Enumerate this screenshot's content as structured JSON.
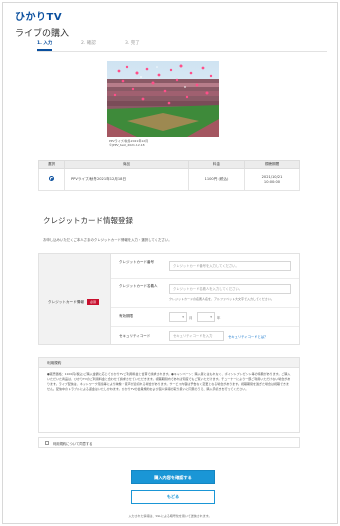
{
  "brand": {
    "logo_text": "ひかりTV",
    "accent": "#0a4f9e",
    "button_blue": "#1a96d6",
    "required_red": "#c8102e"
  },
  "page": {
    "title": "ライブの購入"
  },
  "steps": [
    {
      "label": "1. 入力",
      "active": true
    },
    {
      "label": "2. 確認",
      "active": false
    },
    {
      "label": "3. 完了",
      "active": false
    }
  ],
  "product": {
    "image_alt": "baseball stadium crowd with pink balloons",
    "caption_line1": "PPVライブ/秋冬2021年12月",
    "caption_line2": "©JPPV_test_2021.12.18"
  },
  "order_table": {
    "headers": [
      "選択",
      "商品",
      "料金",
      "視聴期間"
    ],
    "rows": [
      {
        "selected": true,
        "product": "PPVライブ/秋冬2021年12月18日",
        "price": "1100円 (税込)",
        "period_line1": "2021/10/21",
        "period_line2": "10:00:00"
      }
    ]
  },
  "credit": {
    "section_title": "クレジットカード情報登録",
    "note": "お申し込みいただくご本人さまのクレジットカード情報を入力・選択してください。",
    "group_label": "クレジットカード情報",
    "required_badge": "必須",
    "number_label": "クレジットカード番号",
    "number_placeholder": "クレジットカード番号を入力してください。",
    "name_label": "クレジットカード名義人",
    "name_placeholder": "クレジットカード名義人を入力してください。",
    "name_hint": "クレジットカードの名義人名を、アルファベット大文字で入力してください。",
    "expiry_label": "有効期限",
    "expiry_month": "月",
    "expiry_year": "年",
    "security_label": "セキュリティコード",
    "security_placeholder": "セキュリティコードを入力",
    "security_link": "セキュリティコードとは？"
  },
  "terms": {
    "heading": "利用規約",
    "body": "●販売価格：1100円(税込)ご購入金額に応じてひかりTVご利用料金と合算で請求されます。●キャンペーン：購入者にはもれなく、ポイントプレゼント等の特典があります。ご購入いただいた商品は、ひかりTVのご利用料金と合わせて請求させていただきます。視聴期間内であれば何度でもご覧いただけます。チューナーにより一部ご利用いただけない場合があります。ライブ配信は、ネットワーク環境等により映像・音声が途切れる場合があります。サービス内容は予告なく変更となる場合があります。視聴期間を過ぎた場合は視聴できません。配信中のトラブルによる返金はいたしかねます。ひかりTVの会員規約および個人情報の取り扱いに同意のうえ、購入手続きを行ってください。"
  },
  "agree": {
    "label": "利用規約について同意する"
  },
  "buttons": {
    "confirm": "購入内容を確認する",
    "back": "もどる"
  },
  "footnote": "入力された情報は、SSLによる暗号化を用いて送信されます。"
}
